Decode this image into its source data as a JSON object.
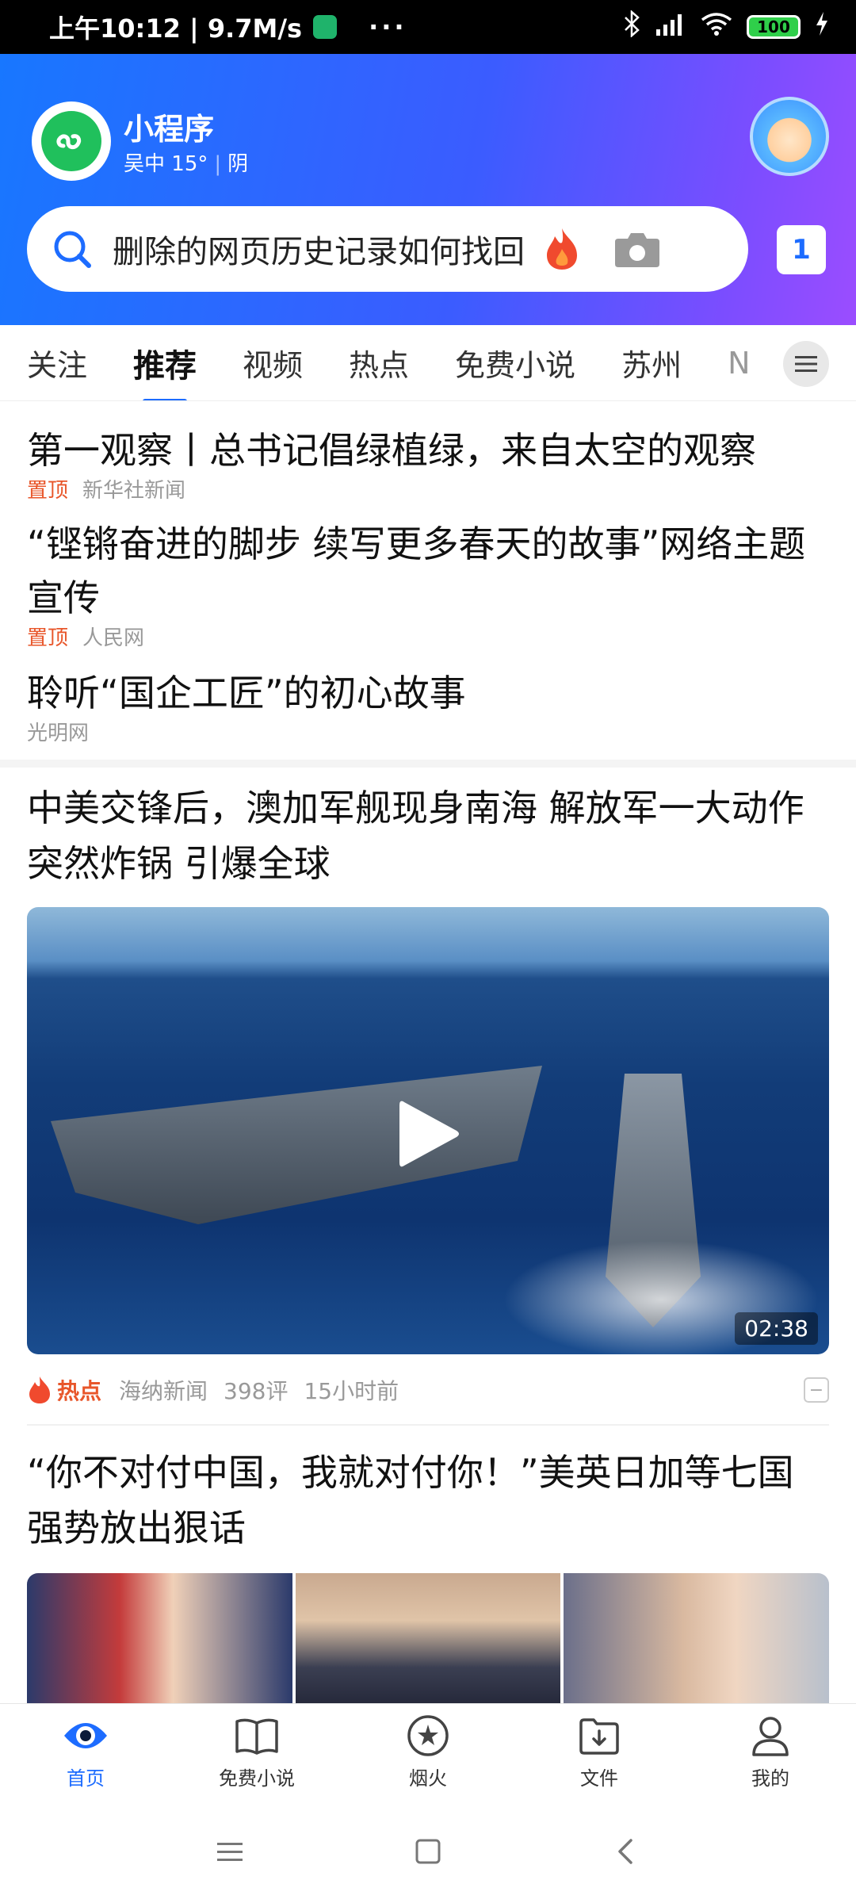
{
  "status_bar": {
    "time_speed": "上午10:12 | 9.7M/s",
    "dots": "···",
    "battery": "100"
  },
  "header": {
    "mini_program_title": "小程序",
    "location": "吴中",
    "temperature": "15°",
    "weather": "阴",
    "search_query": "删除的网页历史记录如何找回",
    "tab_count": "1"
  },
  "channels": [
    {
      "label": "关注"
    },
    {
      "label": "推荐",
      "active": true
    },
    {
      "label": "视频"
    },
    {
      "label": "热点"
    },
    {
      "label": "免费小说"
    },
    {
      "label": "苏州"
    },
    {
      "label": "N"
    }
  ],
  "feed": {
    "pinned": [
      {
        "title": "第一观察丨总书记倡绿植绿，来自太空的观察",
        "tag": "置顶",
        "source": "新华社新闻"
      },
      {
        "title": "“铿锵奋进的脚步 续写更多春天的故事”网络主题宣传",
        "tag": "置顶",
        "source": "人民网"
      },
      {
        "title": "聆听“国企工匠”的初心故事",
        "tag": "",
        "source": "光明网"
      }
    ],
    "video_news": {
      "title": "中美交锋后，澳加军舰现身南海 解放军一大动作突然炸锅 引爆全球",
      "duration": "02:38",
      "hot_tag": "热点",
      "source": "海纳新闻",
      "comments": "398评",
      "time": "15小时前"
    },
    "image_news": {
      "title": "“你不对付中国，我就对付你！”美英日加等七国强势放出狠话"
    }
  },
  "bottom_nav": [
    {
      "label": "首页",
      "icon": "eye-home-icon",
      "active": true
    },
    {
      "label": "免费小说",
      "icon": "book-icon"
    },
    {
      "label": "烟火",
      "icon": "firework-icon"
    },
    {
      "label": "文件",
      "icon": "download-folder-icon"
    },
    {
      "label": "我的",
      "icon": "profile-icon"
    }
  ],
  "colors": {
    "accent": "#1d6cff",
    "hot": "#e8562a",
    "header_gradient_start": "#1877ff",
    "header_gradient_end": "#9b4dff"
  }
}
